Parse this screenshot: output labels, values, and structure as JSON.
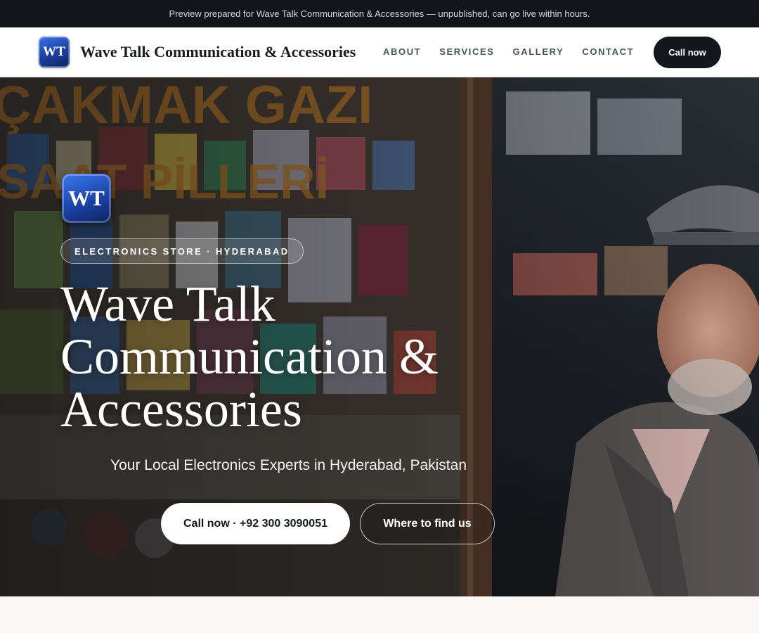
{
  "preview_banner": "Preview prepared for Wave Talk Communication & Accessories — unpublished, can go live within hours.",
  "header": {
    "logo_text": "WT",
    "brand_name": "Wave Talk Communication & Accessories",
    "nav": [
      "ABOUT",
      "SERVICES",
      "GALLERY",
      "CONTACT"
    ],
    "cta_label": "Call now"
  },
  "hero": {
    "logo_text": "WT",
    "badge": "ELECTRONICS STORE · HYDERABAD",
    "title": "Wave Talk Communication & Accessories",
    "subtitle": "Your Local Electronics Experts in Hyderabad, Pakistan",
    "primary_button": "Call now · +92 300 3090051",
    "secondary_button": "Where to find us",
    "background_sign_lines": [
      "ÇAKMAK GAZI",
      "SAAT PİLLERİ"
    ]
  },
  "colors": {
    "topbar_bg": "#111418",
    "brand_blue": "#1b3f9e",
    "dark_button": "#14171c",
    "page_bg": "#faf9f6"
  },
  "icons": [
    "wt-logo"
  ]
}
